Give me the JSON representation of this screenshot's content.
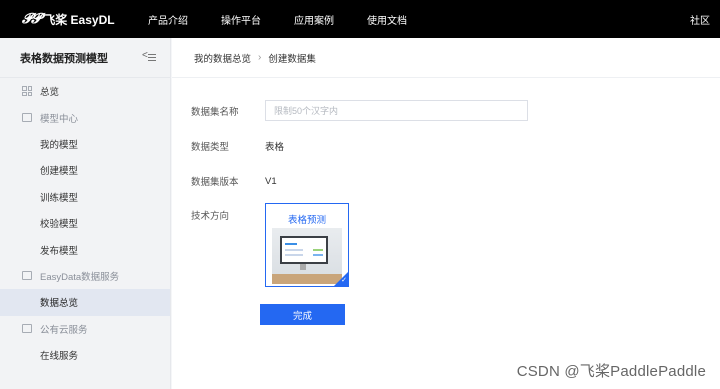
{
  "header": {
    "logo_mark": "𝓟𝓟",
    "logo_text": "飞桨 EasyDL",
    "nav": [
      "产品介绍",
      "操作平台",
      "应用案例",
      "使用文档"
    ],
    "right_link": "社区"
  },
  "sidebar": {
    "title": "表格数据预测模型",
    "items": [
      {
        "label": "总览",
        "kind": "top",
        "icon": "grid-icon"
      },
      {
        "label": "模型中心",
        "kind": "group",
        "icon": "model-icon"
      },
      {
        "label": "我的模型",
        "kind": "sub"
      },
      {
        "label": "创建模型",
        "kind": "sub"
      },
      {
        "label": "训练模型",
        "kind": "sub"
      },
      {
        "label": "校验模型",
        "kind": "sub"
      },
      {
        "label": "发布模型",
        "kind": "sub"
      },
      {
        "label": "EasyData数据服务",
        "kind": "group",
        "icon": "data-icon"
      },
      {
        "label": "数据总览",
        "kind": "sub",
        "active": true
      },
      {
        "label": "公有云服务",
        "kind": "group",
        "icon": "cloud-icon"
      },
      {
        "label": "在线服务",
        "kind": "sub"
      }
    ]
  },
  "breadcrumb": {
    "parent": "我的数据总览",
    "separator": "›",
    "current": "创建数据集"
  },
  "form": {
    "name_label": "数据集名称",
    "name_placeholder": "限制50个汉字内",
    "name_value": "",
    "type_label": "数据类型",
    "type_value": "表格",
    "version_label": "数据集版本",
    "version_value": "V1",
    "direction_label": "技术方向",
    "direction_card_title": "表格预测",
    "submit_label": "完成"
  },
  "watermark": "CSDN @飞桨PaddlePaddle",
  "colors": {
    "primary": "#2468f2",
    "topbar": "#000000",
    "sidebar_bg": "#f2f3f5",
    "active_bg": "#e2e7f1"
  }
}
